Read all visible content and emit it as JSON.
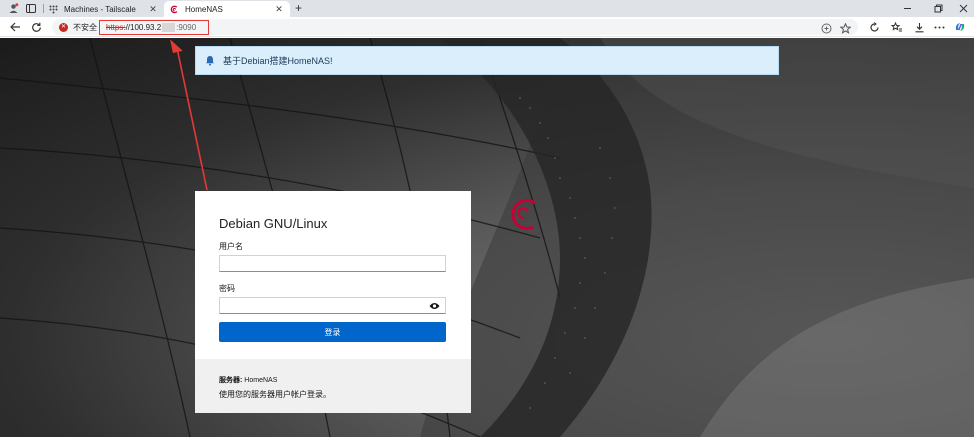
{
  "browser": {
    "tabs": [
      {
        "title": "Machines - Tailscale",
        "active": false
      },
      {
        "title": "HomeNAS",
        "active": true
      }
    ],
    "security_label": "不安全",
    "url": {
      "scheme": "https:",
      "host_visible": "//100.93.2",
      "port": ":9090"
    },
    "colors": {
      "accent": "#0066cc",
      "annotation": "#e53935",
      "debian": "#c70036"
    }
  },
  "page": {
    "notice": "基于Debian搭建HomeNAS!",
    "login": {
      "title": "Debian GNU/Linux",
      "username_label": "用户名",
      "username_value": "",
      "password_label": "密码",
      "password_value": "",
      "submit_label": "登录",
      "server_label": "服务器:",
      "server_name": "HomeNAS",
      "server_note": "使用您的服务器用户帐户登录。"
    }
  }
}
